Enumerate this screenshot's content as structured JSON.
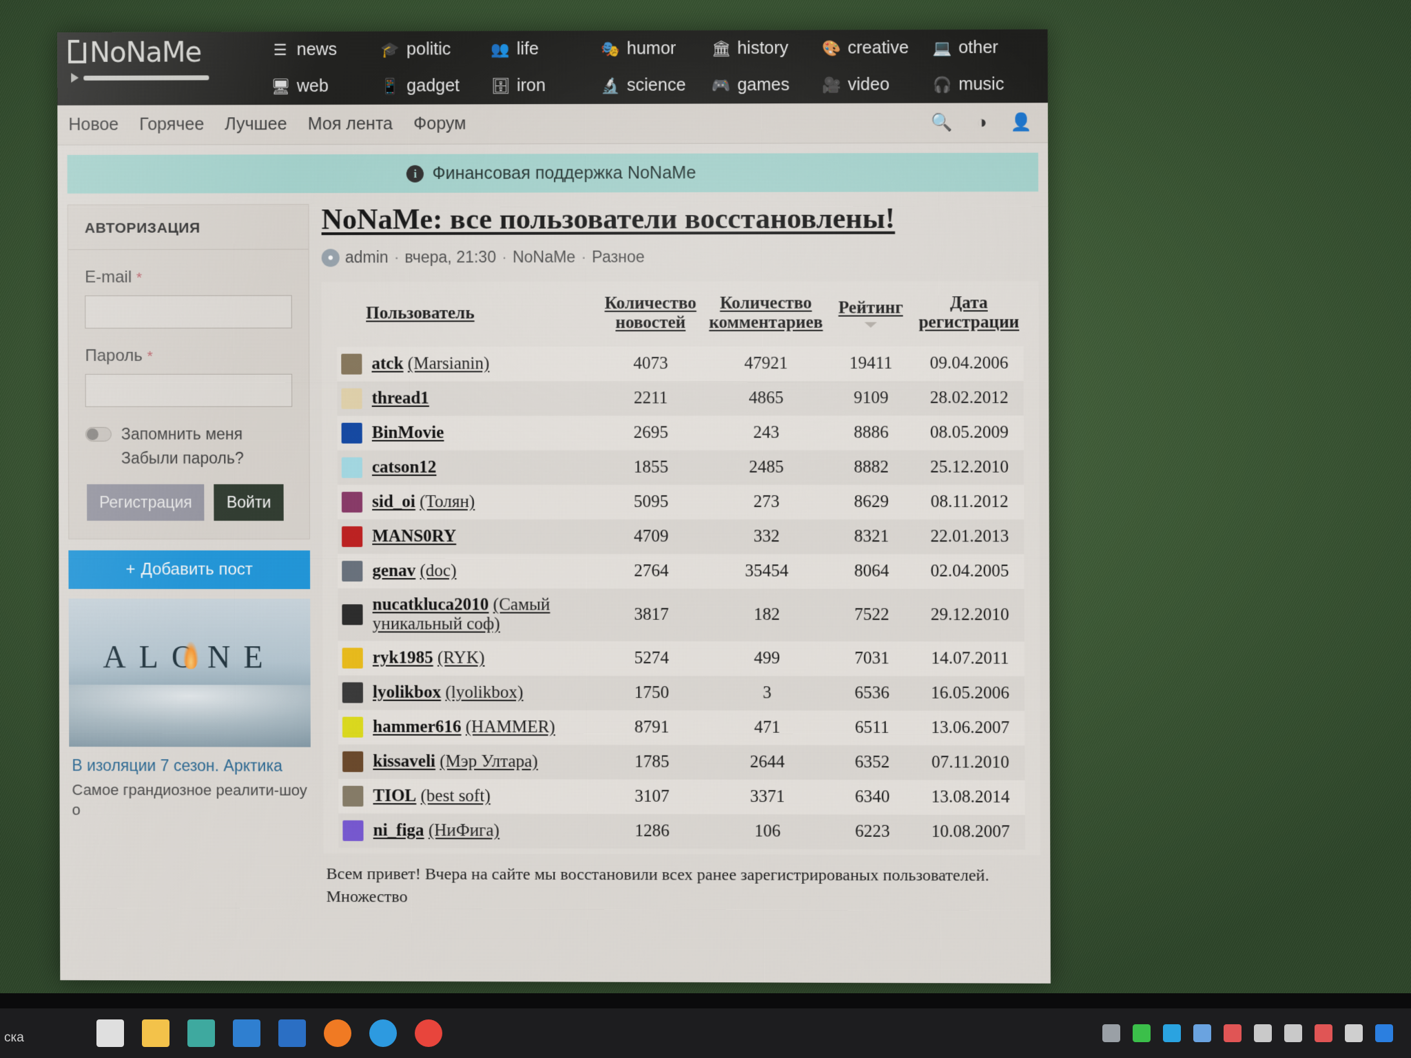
{
  "site": {
    "logo_text": "NoNaMe",
    "nav_primary": [
      {
        "label": "news",
        "icon": "newspaper-icon",
        "glyph": "☰"
      },
      {
        "label": "politic",
        "icon": "graduation-cap-icon",
        "glyph": "🎓"
      },
      {
        "label": "life",
        "icon": "people-icon",
        "glyph": "👥"
      },
      {
        "label": "humor",
        "icon": "mask-icon",
        "glyph": "🎭"
      },
      {
        "label": "history",
        "icon": "monument-icon",
        "glyph": "🏛"
      },
      {
        "label": "creative",
        "icon": "palette-icon",
        "glyph": "🎨"
      },
      {
        "label": "other",
        "icon": "laptop-icon",
        "glyph": "💻"
      },
      {
        "label": "web",
        "icon": "monitor-icon",
        "glyph": "🖥"
      },
      {
        "label": "gadget",
        "icon": "phone-icon",
        "glyph": "📱"
      },
      {
        "label": "iron",
        "icon": "server-icon",
        "glyph": "🗄"
      },
      {
        "label": "science",
        "icon": "microscope-icon",
        "glyph": "🔬"
      },
      {
        "label": "games",
        "icon": "gamepad-icon",
        "glyph": "🎮"
      },
      {
        "label": "video",
        "icon": "video-camera-icon",
        "glyph": "🎥"
      },
      {
        "label": "music",
        "icon": "headphones-icon",
        "glyph": "🎧"
      }
    ],
    "nav_secondary": [
      {
        "label": "Новое"
      },
      {
        "label": "Горячее"
      },
      {
        "label": "Лучшее"
      },
      {
        "label": "Моя лента"
      },
      {
        "label": "Форум"
      }
    ],
    "tools": [
      {
        "name": "search-icon",
        "glyph": "🔍"
      },
      {
        "name": "contrast-icon",
        "glyph": "◑"
      },
      {
        "name": "account-icon",
        "glyph": "👤"
      }
    ]
  },
  "banner": {
    "text": "Финансовая поддержка NoNaMe",
    "icon_glyph": "i",
    "color": "#a8d8d2"
  },
  "auth": {
    "title": "АВТОРИЗАЦИЯ",
    "email_label": "E-mail",
    "email_value": "",
    "password_label": "Пароль",
    "password_value": "",
    "required_mark": "*",
    "remember_label": "Запомнить меня",
    "forgot_label": "Забыли пароль?",
    "register_label": "Регистрация",
    "login_label": "Войти"
  },
  "add_post": {
    "label": "Добавить пост",
    "plus": "+",
    "color": "#1f9ae0"
  },
  "promo": {
    "image_word": "ALONE",
    "title": "В изоляции 7 сезон. Арктика",
    "description": "Самое грандиозное реалити-шоу о"
  },
  "article": {
    "title": "NoNaMe: все пользователи восстановлены!",
    "author": "admin",
    "time": "вчера, 21:30",
    "section": "NoNaMe",
    "category": "Разное",
    "separator": "·",
    "body": "Всем привет! Вчера на сайте мы восстановили всех ранее зарегистрированых пользователей. Множество"
  },
  "table": {
    "columns": [
      {
        "key": "user",
        "label": "Пользователь",
        "label2": ""
      },
      {
        "key": "news",
        "label": "Количество",
        "label2": "новостей"
      },
      {
        "key": "comments",
        "label": "Количество",
        "label2": "комментариев"
      },
      {
        "key": "rating",
        "label": "Рейтинг",
        "label2": "",
        "sorted": true
      },
      {
        "key": "date",
        "label": "Дата",
        "label2": "регистрации"
      }
    ],
    "rows": [
      {
        "name": "atck",
        "alias": "(Marsianin)",
        "news": "4073",
        "comments": "47921",
        "rating": "19411",
        "date": "09.04.2006",
        "avatar": "#8a7a5e"
      },
      {
        "name": "thread1",
        "alias": "",
        "news": "2211",
        "comments": "4865",
        "rating": "9109",
        "date": "28.02.2012",
        "avatar": "#e8d8b0"
      },
      {
        "name": "BinMovie",
        "alias": "",
        "news": "2695",
        "comments": "243",
        "rating": "8886",
        "date": "08.05.2009",
        "avatar": "#1249a8"
      },
      {
        "name": "catson12",
        "alias": "",
        "news": "1855",
        "comments": "2485",
        "rating": "8882",
        "date": "25.12.2010",
        "avatar": "#a8e0ea"
      },
      {
        "name": "sid_oi",
        "alias": "(Толян)",
        "news": "5095",
        "comments": "273",
        "rating": "8629",
        "date": "08.11.2012",
        "avatar": "#8c3a6a"
      },
      {
        "name": "MANS0RY",
        "alias": "",
        "news": "4709",
        "comments": "332",
        "rating": "8321",
        "date": "22.01.2013",
        "avatar": "#c42020"
      },
      {
        "name": "genav",
        "alias": "(doc)",
        "news": "2764",
        "comments": "35454",
        "rating": "8064",
        "date": "02.04.2005",
        "avatar": "#6b7480"
      },
      {
        "name": "nucatkluca2010",
        "alias": "(Самый уникальный соф)",
        "news": "3817",
        "comments": "182",
        "rating": "7522",
        "date": "29.12.2010",
        "avatar": "#2b2b2b"
      },
      {
        "name": "ryk1985",
        "alias": "(RYK)",
        "news": "5274",
        "comments": "499",
        "rating": "7031",
        "date": "14.07.2011",
        "avatar": "#f2c21a"
      },
      {
        "name": "lyolikbox",
        "alias": "(lyolikbox)",
        "news": "1750",
        "comments": "3",
        "rating": "6536",
        "date": "16.05.2006",
        "avatar": "#3a3a3a"
      },
      {
        "name": "hammer616",
        "alias": "(HAMMER)",
        "news": "8791",
        "comments": "471",
        "rating": "6511",
        "date": "13.06.2007",
        "avatar": "#e4e21c"
      },
      {
        "name": "kissaveli",
        "alias": "(Мэр Ултара)",
        "news": "1785",
        "comments": "2644",
        "rating": "6352",
        "date": "07.11.2010",
        "avatar": "#6d4a2b"
      },
      {
        "name": "TIOL",
        "alias": "(best soft)",
        "news": "3107",
        "comments": "3371",
        "rating": "6340",
        "date": "13.08.2014",
        "avatar": "#8a7f6a"
      },
      {
        "name": "ni_figa",
        "alias": "(НиФига)",
        "news": "1286",
        "comments": "106",
        "rating": "6223",
        "date": "10.08.2007",
        "avatar": "#7a5ad8"
      }
    ]
  },
  "taskbar": {
    "search_placeholder": "ска",
    "items": [
      {
        "name": "task-view-icon",
        "color": "#dfdfdf"
      },
      {
        "name": "file-explorer-icon",
        "color": "#f3c24a"
      },
      {
        "name": "calculator-icon",
        "color": "#3ea99f"
      },
      {
        "name": "calendar-icon",
        "color": "#2f7fd0"
      },
      {
        "name": "mail-icon",
        "color": "#2b6fc4"
      },
      {
        "name": "firefox-icon",
        "color": "#f07a23"
      },
      {
        "name": "edge-icon",
        "color": "#2d9ae0"
      },
      {
        "name": "chrome-icon",
        "color": "#e8453c"
      }
    ],
    "tray": [
      {
        "name": "network-icon",
        "color": "#9aa0a6"
      },
      {
        "name": "shield-icon",
        "color": "#3bbf4a"
      },
      {
        "name": "telegram-icon",
        "color": "#2aa3e0"
      },
      {
        "name": "sync-icon",
        "color": "#6aa3e0"
      },
      {
        "name": "antivirus-icon",
        "color": "#e05555"
      },
      {
        "name": "battery-icon",
        "color": "#c9c9c9"
      },
      {
        "name": "volume-icon",
        "color": "#c9c9c9"
      },
      {
        "name": "notification-icon",
        "color": "#e05555"
      },
      {
        "name": "cloud-icon",
        "color": "#cfcfcf"
      },
      {
        "name": "bluetooth-icon",
        "color": "#2b7fe0"
      }
    ]
  }
}
